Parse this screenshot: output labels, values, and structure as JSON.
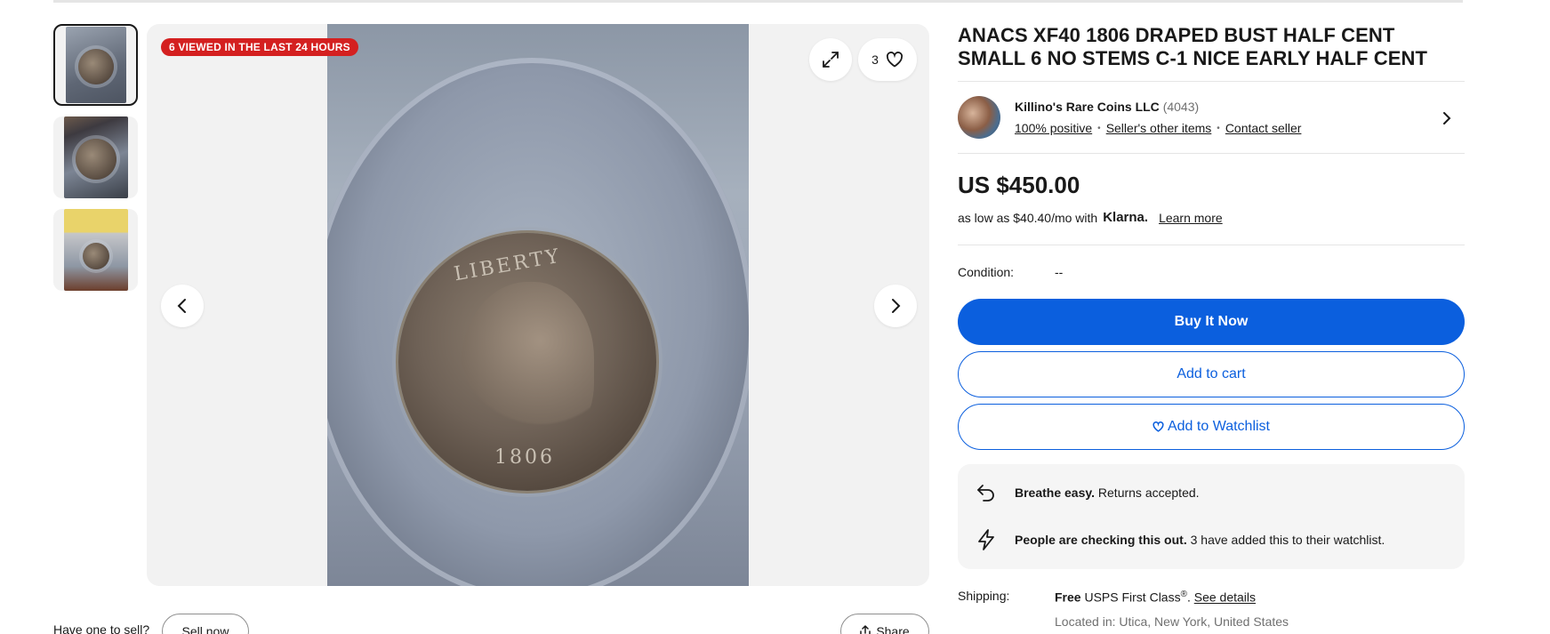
{
  "gallery": {
    "badge": "6 VIEWED IN THE LAST 24 HOURS",
    "watch_count": "3",
    "thumbnails": [
      "coin-thumb-1",
      "coin-thumb-2",
      "coin-thumb-3"
    ],
    "coin_inscription_top": "LIBERTY",
    "coin_inscription_year": "1806"
  },
  "listing": {
    "title": "ANACS XF40 1806 DRAPED BUST HALF CENT SMALL 6 NO STEMS C-1 NICE EARLY HALF CENT"
  },
  "seller": {
    "name": "Killino's Rare Coins LLC",
    "feedback_count": "(4043)",
    "positive": "100% positive",
    "other_items": "Seller's other items",
    "contact": "Contact seller"
  },
  "price": {
    "amount": "US $450.00",
    "installment_prefix": "as low as $40.40/mo with",
    "klarna": "Klarna.",
    "learn_more": "Learn more"
  },
  "condition": {
    "label": "Condition:",
    "value": "--"
  },
  "actions": {
    "buy_now": "Buy It Now",
    "add_cart": "Add to cart",
    "add_watchlist": "Add to Watchlist"
  },
  "info": {
    "returns_bold": "Breathe easy.",
    "returns_text": "Returns accepted.",
    "checking_bold": "People are checking this out.",
    "checking_text": "3 have added this to their watchlist."
  },
  "shipping": {
    "label": "Shipping:",
    "free": "Free",
    "service": "USPS First Class",
    "reg": "®",
    "see_details": "See details",
    "located": "Located in: Utica, New York, United States"
  },
  "footer": {
    "have_one": "Have one to sell?",
    "sell_now": "Sell now",
    "share": "Share"
  },
  "colors": {
    "accent": "#0b5fde",
    "badge": "#d42020",
    "panel": "#f5f5f5"
  }
}
